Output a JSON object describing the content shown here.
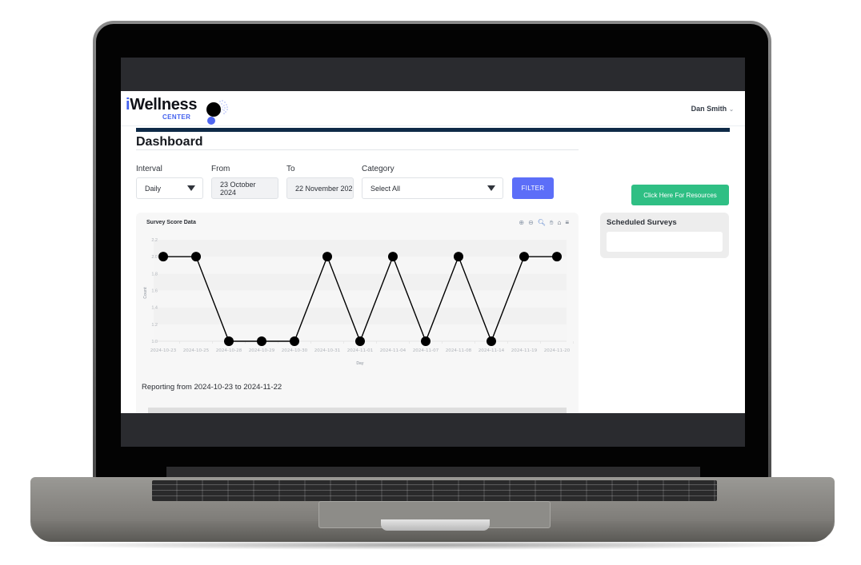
{
  "app": {
    "brand": {
      "name_prefix": "i",
      "name_main": "Wellness",
      "subtitle": "CENTER"
    },
    "user": {
      "name": "Dan Smith",
      "chevron": "⌄"
    },
    "page_title": "Dashboard",
    "filters": {
      "interval": {
        "label": "Interval",
        "value": "Daily"
      },
      "from": {
        "label": "From",
        "value": "23 October 2024"
      },
      "to": {
        "label": "To",
        "value": "22 November 202"
      },
      "category": {
        "label": "Category",
        "value": "Select All"
      },
      "filter_button": "FILTER"
    },
    "resources_button": "Click Here For Resources",
    "scheduled_surveys": {
      "title": "Scheduled Surveys",
      "items": []
    },
    "chart_card": {
      "title": "Survey Score Data",
      "toolbar": [
        {
          "name": "zoom-in-icon",
          "glyph": "⊕"
        },
        {
          "name": "zoom-out-icon",
          "glyph": "⊖"
        },
        {
          "name": "selection-zoom-icon",
          "glyph": "🔍︎"
        },
        {
          "name": "pan-hand-icon",
          "glyph": "✋︎"
        },
        {
          "name": "reset-home-icon",
          "glyph": "⌂"
        },
        {
          "name": "menu-icon",
          "glyph": "≡"
        }
      ],
      "reporting_text": "Reporting from 2024-10-23 to 2024-11-22"
    }
  },
  "chart_data": {
    "type": "line",
    "title": "Survey Score Data",
    "xlabel": "Day",
    "ylabel": "Count",
    "x": [
      "2024-10-23",
      "2024-10-25",
      "2024-10-28",
      "2024-10-29",
      "2024-10-30",
      "2024-10-31",
      "2024-11-01",
      "2024-11-04",
      "2024-11-07",
      "2024-11-08",
      "2024-11-14",
      "2024-11-19",
      "2024-11-20"
    ],
    "series": [
      {
        "name": "Count",
        "values": [
          2,
          2,
          1,
          1,
          1,
          2,
          1,
          2,
          1,
          2,
          1,
          2,
          2
        ],
        "color": "#000000"
      }
    ],
    "ylim": [
      1.0,
      2.2
    ],
    "yticks": [
      "1.0",
      "1.2",
      "1.4",
      "1.6",
      "1.8",
      "2.0",
      "2.2"
    ],
    "grid": true,
    "legend": "none"
  },
  "colors": {
    "brand_blue": "#4361ee",
    "navy": "#0e2a47",
    "filter_button": "#5c6ef8",
    "resources_button": "#2fbf84"
  }
}
